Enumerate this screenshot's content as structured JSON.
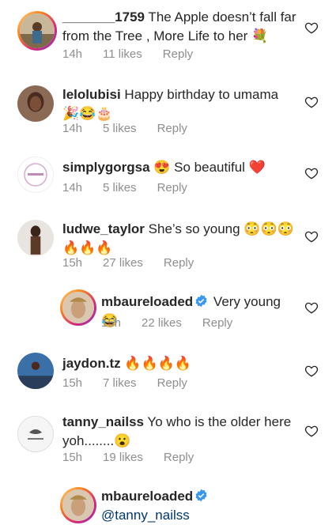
{
  "comments": [
    {
      "username": "_______1759",
      "text": " The Apple doesn’t fall far from the Tree , More Life to her 💐",
      "time": "14h",
      "likes": "11 likes",
      "reply": "Reply"
    },
    {
      "username": "lelolubisi",
      "text": " Happy birthday to umama 🎉😂🎂",
      "time": "14h",
      "likes": "5 likes",
      "reply": "Reply"
    },
    {
      "username": "simplygorgsa",
      "text": " 😍 So beautiful ❤️",
      "time": "14h",
      "likes": "5 likes",
      "reply": "Reply"
    },
    {
      "username": "ludwe_taylor",
      "text": " She’s so young 😳😳😳🔥🔥🔥",
      "time": "15h",
      "likes": "27 likes",
      "reply": "Reply"
    },
    {
      "username": "mbaureloaded",
      "text": " Very young 😂",
      "time": "15h",
      "likes": "22 likes",
      "reply": "Reply"
    },
    {
      "username": "jaydon.tz",
      "text": " 🔥🔥🔥🔥",
      "time": "15h",
      "likes": "7 likes",
      "reply": "Reply"
    },
    {
      "username": "tanny_nailss",
      "text": " Yo who is the older here yoh........😮",
      "time": "15h",
      "likes": "19 likes",
      "reply": "Reply"
    },
    {
      "username": "mbaureloaded",
      "mention": "@tanny_nailss"
    }
  ],
  "icons": {
    "like": "heart-outline-icon",
    "verified": "verified-badge-icon"
  },
  "colors": {
    "verified": "#3897f0",
    "mention": "#00376b",
    "meta": "#8e8e8e"
  }
}
